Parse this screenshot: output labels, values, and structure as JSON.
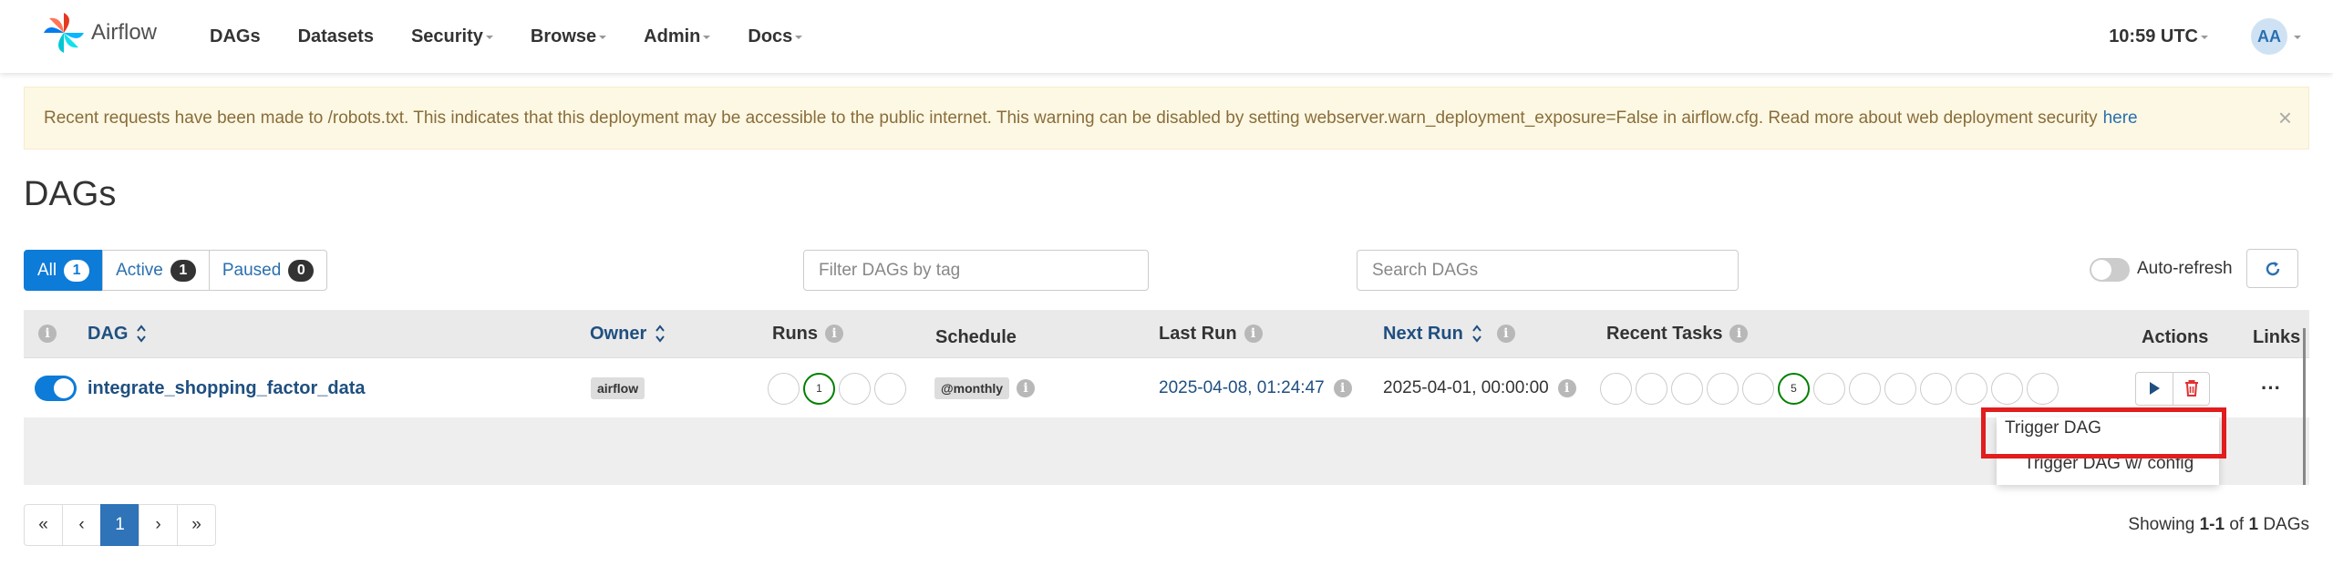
{
  "navbar": {
    "brand": "Airflow",
    "menu": [
      {
        "label": "DAGs",
        "dropdown": false
      },
      {
        "label": "Datasets",
        "dropdown": false
      },
      {
        "label": "Security",
        "dropdown": true
      },
      {
        "label": "Browse",
        "dropdown": true
      },
      {
        "label": "Admin",
        "dropdown": true
      },
      {
        "label": "Docs",
        "dropdown": true
      }
    ],
    "time": "10:59 UTC",
    "avatar": "AA"
  },
  "alert": {
    "text": "Recent requests have been made to /robots.txt. This indicates that this deployment may be accessible to the public internet. This warning can be disabled by setting webserver.warn_deployment_exposure=False in airflow.cfg. Read more about web deployment security",
    "link": "here",
    "close": "×"
  },
  "page_title": "DAGs",
  "filters": {
    "status": [
      {
        "label": "All",
        "count": "1",
        "active": true
      },
      {
        "label": "Active",
        "count": "1",
        "active": false
      },
      {
        "label": "Paused",
        "count": "0",
        "active": false
      }
    ],
    "tag_placeholder": "Filter DAGs by tag",
    "search_placeholder": "Search DAGs",
    "autorefresh": "Auto-refresh"
  },
  "table": {
    "headers": {
      "dag": "DAG",
      "owner": "Owner",
      "runs": "Runs",
      "schedule": "Schedule",
      "last_run": "Last Run",
      "next_run": "Next Run",
      "recent_tasks": "Recent Tasks",
      "actions": "Actions",
      "links": "Links"
    },
    "row": {
      "dag_id": "integrate_shopping_factor_data",
      "owner": "airflow",
      "runs_success": "1",
      "schedule": "@monthly",
      "last_run": "2025-04-08, 01:24:47",
      "next_run": "2025-04-01, 00:00:00",
      "recent_tasks_success": "5",
      "links_icon": "···"
    }
  },
  "dropdown": {
    "items": [
      "Trigger DAG",
      "Trigger DAG w/ config"
    ]
  },
  "pagination": {
    "first": "«",
    "prev": "‹",
    "current": "1",
    "next": "›",
    "last": "»"
  },
  "showing": {
    "prefix": "Showing",
    "range": "1-1",
    "of": "of",
    "total": "1",
    "suffix": "DAGs"
  },
  "colors": {
    "primary": "#0d7bd8",
    "success": "#008000",
    "danger": "#e11d1d",
    "alert_bg": "#fcf8e3"
  }
}
